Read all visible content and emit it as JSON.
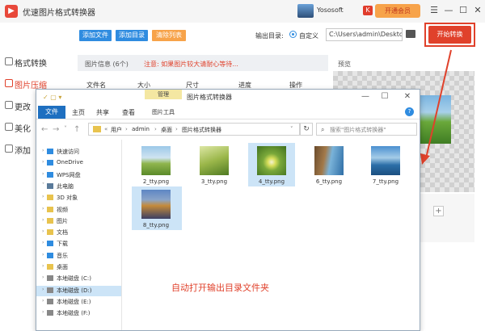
{
  "app": {
    "title": "优速图片格式转换器",
    "logo_glyph": "▶",
    "user_name": "Yososoft",
    "user_badge": "K",
    "vip_button": "开通会员",
    "window_controls": [
      "☰",
      "—",
      "☐",
      "✕"
    ]
  },
  "toolbar": {
    "add_file": "添加文件",
    "add_folder": "添加目录",
    "clear_list": "清除列表",
    "output_label": "输出目录:",
    "radio_custom": "自定义",
    "output_path": "C:\\Users\\admin\\Deskto",
    "start_button": "开始转换"
  },
  "sidebar": {
    "items": [
      {
        "label": "格式转换",
        "icon": "format-convert-icon"
      },
      {
        "label": "图片压缩",
        "icon": "image-compress-icon",
        "color": "#e0412b"
      },
      {
        "label": "更改",
        "icon": "resize-icon"
      },
      {
        "label": "美化",
        "icon": "beautify-icon"
      },
      {
        "label": "添加",
        "icon": "add-watermark-icon"
      }
    ]
  },
  "file_list": {
    "info": "图片信息 (6个)",
    "warning": "注意: 如果图片较大请耐心等待...",
    "columns": [
      "文件名",
      "大小",
      "尺寸",
      "进度",
      "操作"
    ]
  },
  "preview": {
    "label": "预览",
    "plus": "+"
  },
  "explorer": {
    "quick_access": "✓ ▢ ▾",
    "manage_tab": "管理",
    "title": "图片格式转换器",
    "controls": [
      "—",
      "☐",
      "✕"
    ],
    "tabs": {
      "file": "文件",
      "home": "主页",
      "share": "共享",
      "view": "查看",
      "picture_tools": "图片工具"
    },
    "help": "?",
    "nav_arrows": [
      "←",
      "→",
      "˅",
      "↑"
    ],
    "breadcrumbs": [
      "«",
      "用户",
      "›",
      "admin",
      "›",
      "桌面",
      "›",
      "图片格式转换器"
    ],
    "dropdown": "˅",
    "refresh": "↻",
    "search_placeholder": "搜索\"图片格式转换器\"",
    "nav_pane": [
      {
        "label": "快速访问",
        "chev": "›",
        "icon": "star"
      },
      {
        "label": "OneDrive",
        "chev": "›",
        "icon": "cloud"
      },
      {
        "label": "WPS网盘",
        "chev": "›",
        "icon": "cloud"
      },
      {
        "label": "此电脑",
        "chev": "˅",
        "icon": "pc"
      },
      {
        "label": "3D 对象",
        "chev": "›",
        "icon": "folder"
      },
      {
        "label": "视频",
        "chev": "›",
        "icon": "folder"
      },
      {
        "label": "图片",
        "chev": "›",
        "icon": "folder"
      },
      {
        "label": "文档",
        "chev": "›",
        "icon": "folder"
      },
      {
        "label": "下载",
        "chev": "›",
        "icon": "download"
      },
      {
        "label": "音乐",
        "chev": "›",
        "icon": "music"
      },
      {
        "label": "桌面",
        "chev": "›",
        "icon": "folder"
      },
      {
        "label": "本地磁盘 (C:)",
        "chev": "›",
        "icon": "drive"
      },
      {
        "label": "本地磁盘 (D:)",
        "chev": "›",
        "icon": "drive"
      },
      {
        "label": "本地磁盘 (E:)",
        "chev": "›",
        "icon": "drive"
      },
      {
        "label": "本地磁盘 (F:)",
        "chev": "›",
        "icon": "drive"
      }
    ],
    "files": [
      {
        "name": "2_tty.png"
      },
      {
        "name": "3_tty.png"
      },
      {
        "name": "4_tty.png",
        "selected": true
      },
      {
        "name": "6_tty.png"
      },
      {
        "name": "7_tty.png"
      },
      {
        "name": "8_tty.png",
        "selected": true
      }
    ]
  },
  "overlay_message": "自动打开输出目录文件夹"
}
